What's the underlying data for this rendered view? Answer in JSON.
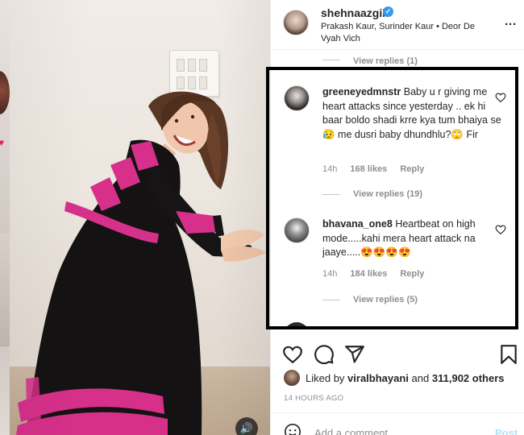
{
  "post": {
    "author_username": "shehnaazgill",
    "audio_line": "Prakash Kaur, Surinder Kaur • Deor De Vyah Vich",
    "more_icon": "more-horizontal-icon"
  },
  "comments": [
    {
      "partial_view_replies": "View replies (1)"
    },
    {
      "username": "greeneyedmnstr",
      "text": "Baby u r giving me heart attacks since yesterday .. ek hi baar boldo shadi krre kya tum bhaiya se 😥 me dusri baby dhundhlu?🙄 Fir",
      "time": "14h",
      "likes": "168 likes",
      "reply": "Reply",
      "view_replies": "View replies (19)"
    },
    {
      "username": "bhavana_one8",
      "text": "Heartbeat on high mode.....kahi mera heart attack na jaaye.....😍😍😍😍",
      "time": "14h",
      "likes": "184 likes",
      "reply": "Reply",
      "view_replies": "View replies (5)"
    }
  ],
  "actions": {
    "icons": [
      "heart-icon",
      "comment-icon",
      "share-icon",
      "bookmark-icon"
    ]
  },
  "likes": {
    "prefix": "Liked by",
    "user": "viralbhayani",
    "conjunction": "and",
    "count": "311,902 others"
  },
  "time_ago": "14 HOURS AGO",
  "composer": {
    "placeholder": "Add a comment...",
    "post_label": "Post"
  },
  "colors": {
    "link_blue": "#0095f6",
    "verified_blue": "#3897f0",
    "muted_gray": "#8e8e8e",
    "highlight_border": "#000000"
  }
}
